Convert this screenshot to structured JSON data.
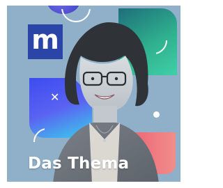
{
  "podcast": {
    "brand_logo_letter": "m",
    "title": "Das Thema"
  },
  "colors": {
    "background": "#8fb0c8",
    "logo_blue": "#2a44a8",
    "teal": "#2fb08e",
    "blue": "#4a58f0",
    "pink": "#ee6f7c"
  }
}
